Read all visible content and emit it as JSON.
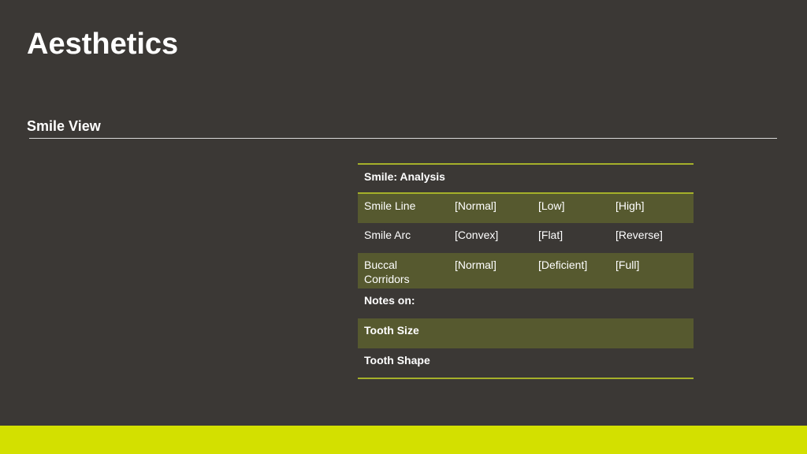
{
  "slide": {
    "title": "Aesthetics",
    "section_heading": "Smile View"
  },
  "table": {
    "header": "Smile: Analysis",
    "rows": [
      {
        "label": "Smile Line",
        "options": [
          "[Normal]",
          "[Low]",
          "[High]"
        ]
      },
      {
        "label": "Smile Arc",
        "options": [
          "[Convex]",
          "[Flat]",
          "[Reverse]"
        ]
      },
      {
        "label": "Buccal Corridors",
        "options": [
          "[Normal]",
          "[Deficient]",
          "[Full]"
        ]
      }
    ],
    "notes_label": "Notes on:",
    "notes_items": [
      "Tooth Size",
      "Tooth Shape"
    ]
  },
  "colors": {
    "background": "#3b3835",
    "accent_bar": "#d3e000",
    "table_rule": "#a5b02a",
    "row_shade": "#56592f"
  }
}
